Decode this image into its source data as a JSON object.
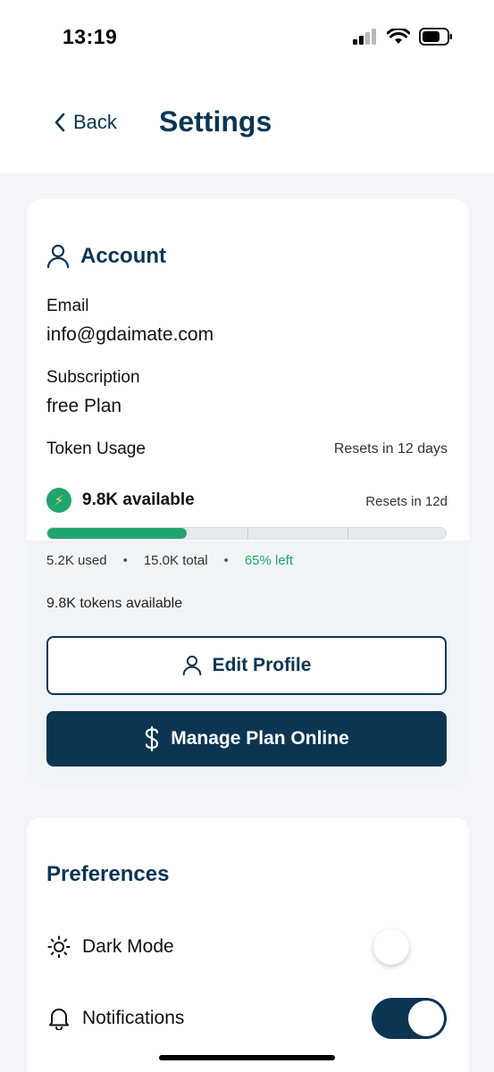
{
  "status_bar": {
    "time": "13:19"
  },
  "header": {
    "back_label": "Back",
    "title": "Settings"
  },
  "account": {
    "title": "Account",
    "email_label": "Email",
    "email_value": "info@gdaimate.com",
    "subscription_label": "Subscription",
    "subscription_value": "free Plan",
    "token_usage_label": "Token Usage",
    "token_usage_reset": "Resets in 12 days",
    "available": "9.8K available",
    "reset_short": "Resets in 12d",
    "progress_used_fraction": 0.35,
    "used": "5.2K used",
    "total": "15.0K total",
    "left": "65% left",
    "separator": "•",
    "tokens_available": "9.8K tokens available",
    "edit_profile_label": "Edit Profile",
    "manage_plan_label": "Manage Plan Online"
  },
  "preferences": {
    "title": "Preferences",
    "items": [
      {
        "label": "Dark Mode",
        "icon": "sun-icon",
        "enabled": false
      },
      {
        "label": "Notifications",
        "icon": "bell-icon",
        "enabled": true
      }
    ]
  },
  "colors": {
    "primary": "#0b3553",
    "accent": "#1fa56d",
    "background": "#f3f5f8"
  }
}
